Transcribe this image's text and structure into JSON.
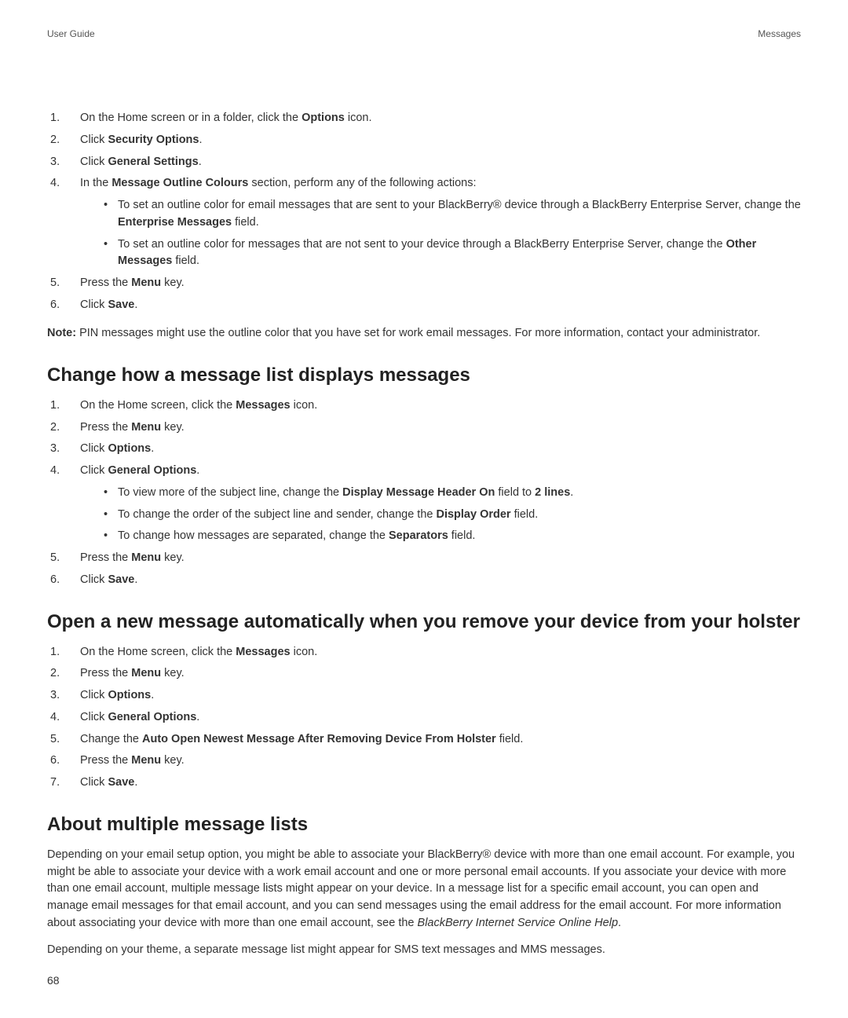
{
  "header": {
    "left": "User Guide",
    "right": "Messages"
  },
  "section1": {
    "steps": {
      "s1_pre": "On the Home screen or in a folder, click the ",
      "s1_bold": "Options",
      "s1_post": " icon.",
      "s2_pre": "Click ",
      "s2_bold": "Security Options",
      "s2_post": ".",
      "s3_pre": "Click ",
      "s3_bold": "General Settings",
      "s3_post": ".",
      "s4_pre": "In the ",
      "s4_bold": "Message Outline Colours",
      "s4_post": " section, perform any of the following actions:",
      "s4a_pre": "To set an outline color for email messages that are sent to your BlackBerry® device through a BlackBerry Enterprise Server, change the ",
      "s4a_bold": "Enterprise Messages",
      "s4a_post": " field.",
      "s4b_pre": "To set an outline color for messages that are not sent to your device through a BlackBerry Enterprise Server, change the ",
      "s4b_bold": "Other Messages",
      "s4b_post": " field.",
      "s5_pre": "Press the ",
      "s5_bold": "Menu",
      "s5_post": " key.",
      "s6_pre": "Click ",
      "s6_bold": "Save",
      "s6_post": "."
    },
    "note_label": "Note:",
    "note_text": "  PIN messages might use the outline color that you have set for work email messages. For more information, contact your administrator."
  },
  "section2": {
    "heading": "Change how a message list displays messages",
    "steps": {
      "s1_pre": "On the Home screen, click the ",
      "s1_bold": "Messages",
      "s1_post": " icon.",
      "s2_pre": "Press the ",
      "s2_bold": "Menu",
      "s2_post": " key.",
      "s3_pre": "Click ",
      "s3_bold": "Options",
      "s3_post": ".",
      "s4_pre": "Click ",
      "s4_bold": "General Options",
      "s4_post": ".",
      "s4a_pre": "To view more of the subject line, change the ",
      "s4a_bold1": "Display Message Header On",
      "s4a_mid": " field to ",
      "s4a_bold2": "2 lines",
      "s4a_post": ".",
      "s4b_pre": "To change the order of the subject line and sender, change the ",
      "s4b_bold": "Display Order",
      "s4b_post": " field.",
      "s4c_pre": "To change how messages are separated, change the ",
      "s4c_bold": "Separators",
      "s4c_post": " field.",
      "s5_pre": "Press the ",
      "s5_bold": "Menu",
      "s5_post": " key.",
      "s6_pre": "Click ",
      "s6_bold": "Save",
      "s6_post": "."
    }
  },
  "section3": {
    "heading": "Open a new message automatically when you remove your device from your holster",
    "steps": {
      "s1_pre": "On the Home screen, click the ",
      "s1_bold": "Messages",
      "s1_post": " icon.",
      "s2_pre": "Press the ",
      "s2_bold": "Menu",
      "s2_post": " key.",
      "s3_pre": "Click ",
      "s3_bold": "Options",
      "s3_post": ".",
      "s4_pre": "Click ",
      "s4_bold": "General Options",
      "s4_post": ".",
      "s5_pre": "Change the ",
      "s5_bold": "Auto Open Newest Message After Removing Device From Holster",
      "s5_post": " field.",
      "s6_pre": "Press the ",
      "s6_bold": "Menu",
      "s6_post": " key.",
      "s7_pre": "Click ",
      "s7_bold": "Save",
      "s7_post": "."
    }
  },
  "section4": {
    "heading": "About multiple message lists",
    "para1_pre": "Depending on your email setup option, you might be able to associate your BlackBerry® device with more than one email account. For example, you might be able to associate your device with a work email account and one or more personal email accounts. If you associate your device with more than one email account, multiple message lists might appear on your device. In a message list for a specific email account, you can open and manage email messages for that email account, and you can send messages using the email address for the email account. For more information about associating your device with more than one email account, see the  ",
    "para1_italic": "BlackBerry Internet Service Online Help",
    "para1_post": ".",
    "para2": "Depending on your theme, a separate message list might appear for SMS text messages and MMS messages."
  },
  "page_number": "68"
}
